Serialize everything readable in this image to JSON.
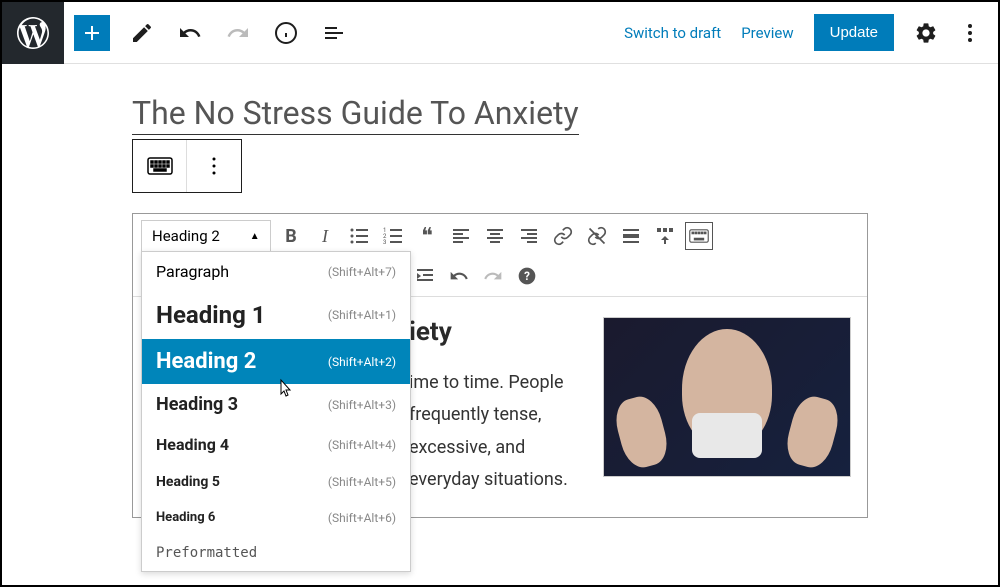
{
  "topbar": {
    "switch_to_draft": "Switch to draft",
    "preview": "Preview",
    "update": "Update"
  },
  "post": {
    "title": "The No Stress Guide To Anxiety"
  },
  "tinymce": {
    "format_current": "Heading 2",
    "dropdown": [
      {
        "label": "Paragraph",
        "shortcut": "(Shift+Alt+7)",
        "cls": "dd-paragraph"
      },
      {
        "label": "Heading 1",
        "shortcut": "(Shift+Alt+1)",
        "cls": "dd-h1"
      },
      {
        "label": "Heading 2",
        "shortcut": "(Shift+Alt+2)",
        "cls": "dd-h2",
        "selected": true
      },
      {
        "label": "Heading 3",
        "shortcut": "(Shift+Alt+3)",
        "cls": "dd-h3"
      },
      {
        "label": "Heading 4",
        "shortcut": "(Shift+Alt+4)",
        "cls": "dd-h4"
      },
      {
        "label": "Heading 5",
        "shortcut": "(Shift+Alt+5)",
        "cls": "dd-h5"
      },
      {
        "label": "Heading 6",
        "shortcut": "(Shift+Alt+6)",
        "cls": "dd-h6"
      },
      {
        "label": "Preformatted",
        "shortcut": "",
        "cls": "dd-pre"
      }
    ]
  },
  "content": {
    "heading_partial": "iety",
    "paragraph_visible": "ime to time. People  frequently tense, excessive, and  everyday situations."
  }
}
